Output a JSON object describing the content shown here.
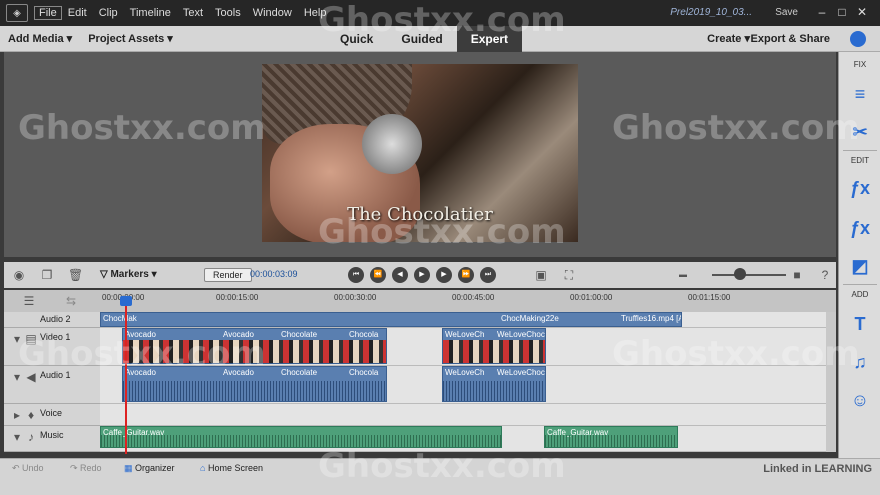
{
  "menubar": {
    "items": [
      "File",
      "Edit",
      "Clip",
      "Timeline",
      "Text",
      "Tools",
      "Window",
      "Help"
    ],
    "project": "Prel2019_10_03...",
    "save": "Save"
  },
  "toolbar": {
    "add_media": "Add Media",
    "project_assets": "Project Assets",
    "modes": [
      "Quick",
      "Guided",
      "Expert"
    ],
    "active_mode": "Expert",
    "create": "Create",
    "export_share": "Export & Share"
  },
  "monitor": {
    "title": "The Chocolatier"
  },
  "sidepanel": {
    "fix": "FIX",
    "edit": "EDIT",
    "add": "ADD"
  },
  "timeline_toolbar": {
    "markers": "Markers",
    "render": "Render",
    "timecode": "00:00:03:09"
  },
  "ruler": [
    "00:00:00:00",
    "00:00:15:00",
    "00:00:30:00",
    "00:00:45:00",
    "00:01:00:00",
    "00:01:15:00"
  ],
  "tracks": {
    "audio2": "Audio 2",
    "video1": "Video 1",
    "audio1": "Audio 1",
    "voice": "Voice",
    "music": "Music"
  },
  "clips": {
    "audio2": [
      "ChocMak",
      "ChocM",
      "Avo",
      "Avoca",
      "Avoc",
      "Avocado",
      "Avoc",
      "Chocol",
      "Choc",
      "Avocado",
      "Chocola",
      "Choc",
      "Choc",
      "ChocMak",
      "WeLoveC",
      "ChocMak",
      "ChocMaking22e",
      "Truffles16.mp4 [A]"
    ],
    "video1": [
      "Avocado",
      "Avo",
      "Avoca",
      "Avocado",
      "Avocado",
      "Chocolate",
      "Avocado",
      "Chocola",
      "WeLoveCh",
      "WeL",
      "WeLoveChocola"
    ],
    "audio1": [
      "Avocado",
      "Avo",
      "Avoca",
      "Avocado",
      "Avocado",
      "Chocolate",
      "Avocado",
      "Chocola",
      "WeLoveCh",
      "WeL",
      "WeLoveChocola"
    ],
    "music": [
      "Caffe_Guitar.wav",
      "Caffe_Guitar.wav"
    ]
  },
  "bottombar": {
    "undo": "Undo",
    "redo": "Redo",
    "organizer": "Organizer",
    "home": "Home Screen"
  },
  "branding": "Linked in LEARNING",
  "watermark": "Ghostxx.com",
  "colors": {
    "accent": "#2a6bd0",
    "video_clip": "#5a7fb0",
    "music_clip": "#4ea07a",
    "playhead": "#d22222"
  }
}
